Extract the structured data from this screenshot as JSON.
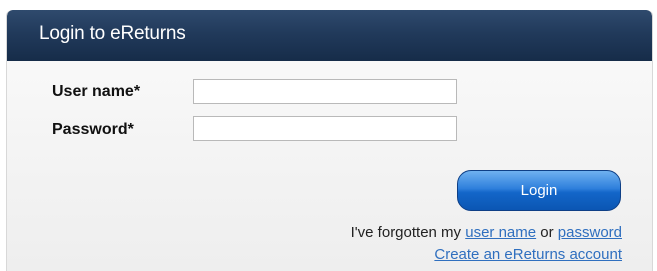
{
  "login_panel": {
    "title": "Login to eReturns",
    "username": {
      "label": "User name*",
      "value": ""
    },
    "password": {
      "label": "Password*",
      "value": ""
    },
    "login_button_label": "Login",
    "forgot": {
      "prefix": "I've forgotten my",
      "username_link": "user name",
      "connector": "or",
      "password_link": "password"
    },
    "create_account_link": "Create an eReturns account"
  },
  "colors": {
    "header": "#213a5b",
    "button": "#2e7fdc",
    "link": "#2f6fbf"
  }
}
